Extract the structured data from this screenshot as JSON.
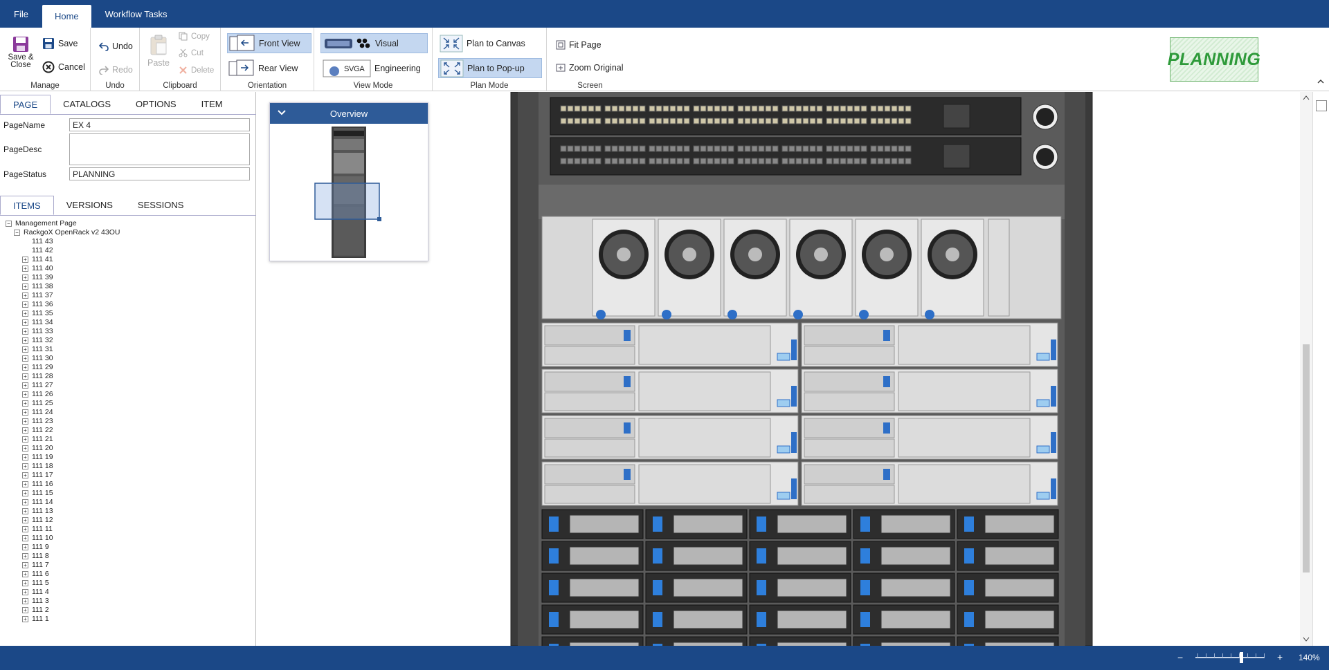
{
  "menu": {
    "file": "File",
    "home": "Home",
    "workflow": "Workflow Tasks"
  },
  "ribbon": {
    "manage": {
      "save_close": "Save & Close",
      "save": "Save",
      "cancel": "Cancel",
      "label": "Manage"
    },
    "undo": {
      "undo": "Undo",
      "redo": "Redo",
      "label": "Undo"
    },
    "clipboard": {
      "paste": "Paste",
      "copy": "Copy",
      "cut": "Cut",
      "delete": "Delete",
      "label": "Clipboard"
    },
    "orientation": {
      "front": "Front View",
      "rear": "Rear View",
      "label": "Orientation"
    },
    "view_mode": {
      "visual": "Visual",
      "svga": "SVGA",
      "engineering": "Engineering",
      "label": "View Mode"
    },
    "plan_mode": {
      "canvas": "Plan to Canvas",
      "popup": "Plan to Pop-up",
      "label": "Plan Mode"
    },
    "screen": {
      "fit": "Fit Page",
      "zoom_original": "Zoom Original",
      "label": "Screen"
    },
    "status_badge": "PLANNING"
  },
  "page_tabs": [
    "PAGE",
    "CATALOGS",
    "OPTIONS",
    "ITEM"
  ],
  "page_form": {
    "name_label": "PageName",
    "name_value": "EX 4",
    "desc_label": "PageDesc",
    "desc_value": "",
    "status_label": "PageStatus",
    "status_value": "PLANNING"
  },
  "items_tabs": [
    "ITEMS",
    "VERSIONS",
    "SESSIONS"
  ],
  "tree": {
    "root": "Management Page",
    "rack": "RackgoX OpenRack v2 43OU",
    "items": [
      "111 43",
      "111 42",
      "111 41",
      "111 40",
      "111 39",
      "111 38",
      "111 37",
      "111 36",
      "111 35",
      "111 34",
      "111 33",
      "111 32",
      "111 31",
      "111 30",
      "111 29",
      "111 28",
      "111 27",
      "111 26",
      "111 25",
      "111 24",
      "111 23",
      "111 22",
      "111 21",
      "111 20",
      "111 19",
      "111 18",
      "111 17",
      "111 16",
      "111 15",
      "111 14",
      "111 13",
      "111 12",
      "111 11",
      "111 10",
      "111 9",
      "111 8",
      "111 7",
      "111 6",
      "111 5",
      "111 4",
      "111 3",
      "111 2",
      "111 1"
    ],
    "expandable_from": 2
  },
  "overview": {
    "title": "Overview"
  },
  "status": {
    "minus": "−",
    "plus": "+",
    "zoom": "140%"
  },
  "colors": {
    "brand": "#1b4887",
    "accent_green": "#2e9a3a",
    "selected": "#c4d7f0"
  }
}
